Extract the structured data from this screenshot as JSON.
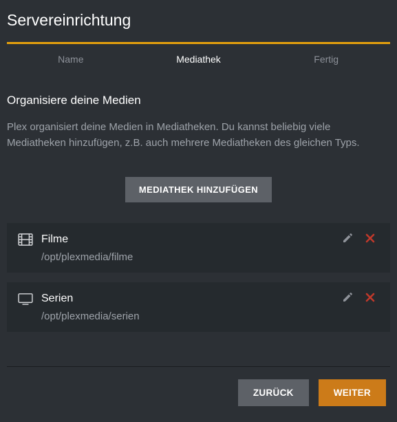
{
  "title": "Servereinrichtung",
  "tabs": {
    "name": "Name",
    "mediathek": "Mediathek",
    "fertig": "Fertig",
    "activeIndex": 1
  },
  "section": {
    "heading": "Organisiere deine Medien",
    "description": "Plex organisiert deine Medien in Mediatheken. Du kannst beliebig viele Mediatheken hinzufügen, z.B. auch mehrere Mediatheken des gleichen Typs."
  },
  "buttons": {
    "add": "MEDIATHEK HINZUFÜGEN",
    "back": "ZURÜCK",
    "next": "WEITER"
  },
  "icons": {
    "film": "film-icon",
    "tv": "tv-icon",
    "edit": "pencil-icon",
    "delete": "close-icon"
  },
  "colors": {
    "accent": "#e5a00d",
    "danger": "#c0392b",
    "muted": "#8d9199"
  },
  "libraries": [
    {
      "type": "film",
      "name": "Filme",
      "path": "/opt/plexmedia/filme"
    },
    {
      "type": "tv",
      "name": "Serien",
      "path": "/opt/plexmedia/serien"
    }
  ]
}
